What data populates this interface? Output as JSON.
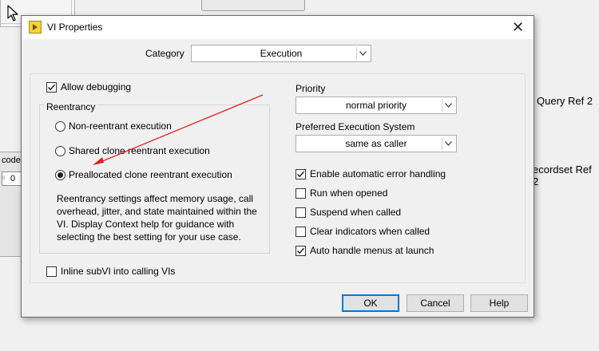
{
  "dialog": {
    "title": "VI Properties",
    "close_glyph": "✕"
  },
  "category": {
    "label": "Category",
    "value": "Execution"
  },
  "allow_debugging": {
    "label": "Allow debugging",
    "checked": true
  },
  "reentrancy": {
    "legend": "Reentrancy",
    "options": [
      {
        "label": "Non-reentrant execution",
        "selected": false
      },
      {
        "label": "Shared clone reentrant execution",
        "selected": false
      },
      {
        "label": "Preallocated clone reentrant execution",
        "selected": true
      }
    ],
    "description": "Reentrancy settings affect memory usage, call overhead, jitter, and state maintained within the VI. Display Context help for guidance with selecting the best setting for your use case."
  },
  "inline_subvi": {
    "label": "Inline subVI into calling VIs",
    "checked": false
  },
  "priority": {
    "label": "Priority",
    "value": "normal priority"
  },
  "execution_system": {
    "label": "Preferred Execution System",
    "value": "same as caller"
  },
  "options": [
    {
      "label": "Enable automatic error handling",
      "checked": true
    },
    {
      "label": "Run when opened",
      "checked": false
    },
    {
      "label": "Suspend when called",
      "checked": false
    },
    {
      "label": "Clear indicators when called",
      "checked": false
    },
    {
      "label": "Auto handle menus at launch",
      "checked": true
    }
  ],
  "buttons": {
    "ok": "OK",
    "cancel": "Cancel",
    "help": "Help"
  },
  "background": {
    "code_label": "code",
    "numeric_value": "0",
    "numeric_inc": "◊",
    "right_label_1": "Query Ref 2",
    "right_label_2": "ecordset Ref 2"
  },
  "colors": {
    "annotation_arrow": "#e02020",
    "default_button_border": "#0078d7"
  }
}
